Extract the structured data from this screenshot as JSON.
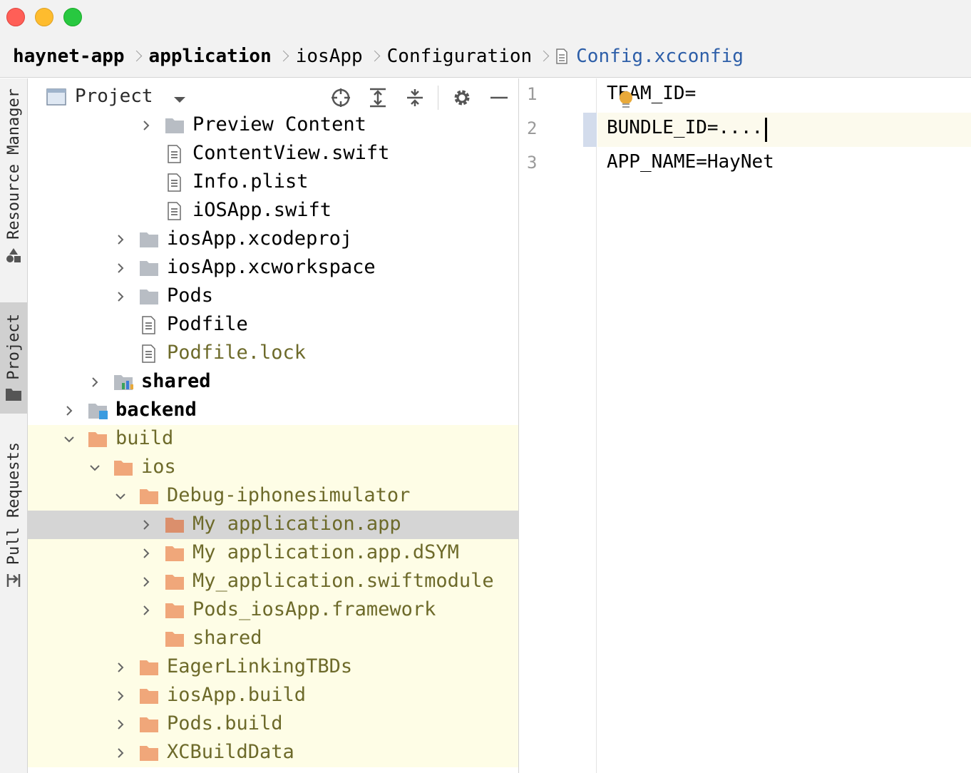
{
  "window": {
    "controls": [
      "close",
      "minimize",
      "maximize"
    ]
  },
  "breadcrumb": [
    {
      "label": "haynet-app",
      "bold": true
    },
    {
      "label": "application",
      "bold": true
    },
    {
      "label": "iosApp"
    },
    {
      "label": "Configuration"
    },
    {
      "label": "Config.xcconfig",
      "icon": "text-file-icon",
      "file": true
    }
  ],
  "toolstrip": {
    "tabs": [
      {
        "label": "Resource Manager",
        "icon": "resource-manager-icon"
      },
      {
        "label": "Project",
        "icon": "folder-icon",
        "active": true
      },
      {
        "label": "Pull Requests",
        "icon": "pull-request-icon"
      }
    ]
  },
  "project_panel": {
    "title": "Project",
    "toolbar_icons": [
      "locate-icon",
      "expand-all-icon",
      "collapse-all-icon",
      "gear-icon",
      "hide-icon"
    ],
    "tree": [
      {
        "label": "Preview Content",
        "depth": 4,
        "expandable": true,
        "expanded": false,
        "icon": "folder-gray"
      },
      {
        "label": "ContentView.swift",
        "depth": 4,
        "icon": "file"
      },
      {
        "label": "Info.plist",
        "depth": 4,
        "icon": "file"
      },
      {
        "label": "iOSApp.swift",
        "depth": 4,
        "icon": "file"
      },
      {
        "label": "iosApp.xcodeproj",
        "depth": 3,
        "expandable": true,
        "expanded": false,
        "icon": "folder-gray"
      },
      {
        "label": "iosApp.xcworkspace",
        "depth": 3,
        "expandable": true,
        "expanded": false,
        "icon": "folder-gray"
      },
      {
        "label": "Pods",
        "depth": 3,
        "expandable": true,
        "expanded": false,
        "icon": "folder-gray"
      },
      {
        "label": "Podfile",
        "depth": 3,
        "icon": "file"
      },
      {
        "label": "Podfile.lock",
        "depth": 3,
        "icon": "file",
        "excluded": true
      },
      {
        "label": "shared",
        "depth": 2,
        "expandable": true,
        "expanded": false,
        "icon": "module",
        "bold": true
      },
      {
        "label": "backend",
        "depth": 1,
        "expandable": true,
        "expanded": false,
        "icon": "module-blue",
        "bold": true
      },
      {
        "label": "build",
        "depth": 1,
        "expandable": true,
        "expanded": true,
        "icon": "folder-orange",
        "excluded": true,
        "highlight": true
      },
      {
        "label": "ios",
        "depth": 2,
        "expandable": true,
        "expanded": true,
        "icon": "folder-orange",
        "excluded": true,
        "highlight": true
      },
      {
        "label": "Debug-iphonesimulator",
        "depth": 3,
        "expandable": true,
        "expanded": true,
        "icon": "folder-orange",
        "excluded": true,
        "highlight": true
      },
      {
        "label": "My application.app",
        "depth": 4,
        "expandable": true,
        "expanded": false,
        "icon": "folder-orange-dark",
        "excluded": true,
        "selected": true
      },
      {
        "label": "My application.app.dSYM",
        "depth": 4,
        "expandable": true,
        "expanded": false,
        "icon": "folder-orange",
        "excluded": true,
        "highlight": true
      },
      {
        "label": "My_application.swiftmodule",
        "depth": 4,
        "expandable": true,
        "expanded": false,
        "icon": "folder-orange",
        "excluded": true,
        "highlight": true
      },
      {
        "label": "Pods_iosApp.framework",
        "depth": 4,
        "expandable": true,
        "expanded": false,
        "icon": "folder-orange",
        "excluded": true,
        "highlight": true
      },
      {
        "label": "shared",
        "depth": 4,
        "icon": "folder-orange",
        "excluded": true,
        "highlight": true
      },
      {
        "label": "EagerLinkingTBDs",
        "depth": 3,
        "expandable": true,
        "expanded": false,
        "icon": "folder-orange",
        "excluded": true,
        "highlight": true
      },
      {
        "label": "iosApp.build",
        "depth": 3,
        "expandable": true,
        "expanded": false,
        "icon": "folder-orange",
        "excluded": true,
        "highlight": true
      },
      {
        "label": "Pods.build",
        "depth": 3,
        "expandable": true,
        "expanded": false,
        "icon": "folder-orange",
        "excluded": true,
        "highlight": true
      },
      {
        "label": "XCBuildData",
        "depth": 3,
        "expandable": true,
        "expanded": false,
        "icon": "folder-orange",
        "excluded": true,
        "highlight": true
      }
    ]
  },
  "editor": {
    "file": "Config.xcconfig",
    "current_line": 2,
    "lines": [
      {
        "number": "1",
        "text": "TEAM_ID="
      },
      {
        "number": "2",
        "text": "BUNDLE_ID=...."
      },
      {
        "number": "3",
        "text": "APP_NAME=HayNet"
      }
    ],
    "intention_icon": "lightbulb-icon"
  },
  "colors": {
    "excluded_text": "#6d6a2a",
    "excluded_background": "#fefde6",
    "selection": "#d5d5d5",
    "folder_gray": "#b8bdc4",
    "folder_orange": "#f0a77a",
    "file_link": "#2d5ea8",
    "current_line": "#fcfaed"
  }
}
